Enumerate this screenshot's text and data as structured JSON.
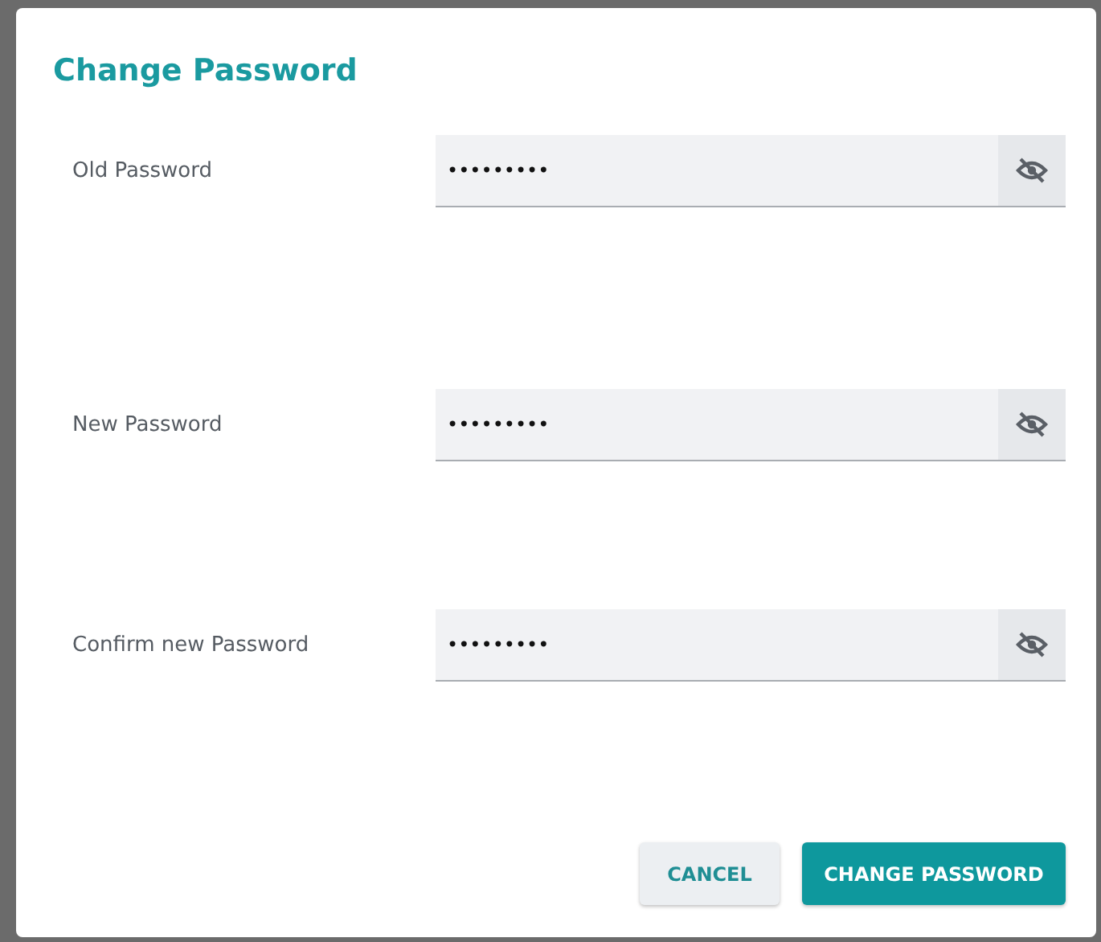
{
  "dialog": {
    "title": "Change Password",
    "fields": [
      {
        "label": "Old Password",
        "value": "•••••••••"
      },
      {
        "label": "New Password",
        "value": "•••••••••"
      },
      {
        "label": "Confirm new Password",
        "value": "•••••••••"
      }
    ],
    "buttons": [
      {
        "label": "CANCEL",
        "kind": "secondary"
      },
      {
        "label": "CHANGE PASSWORD",
        "kind": "primary"
      }
    ]
  }
}
